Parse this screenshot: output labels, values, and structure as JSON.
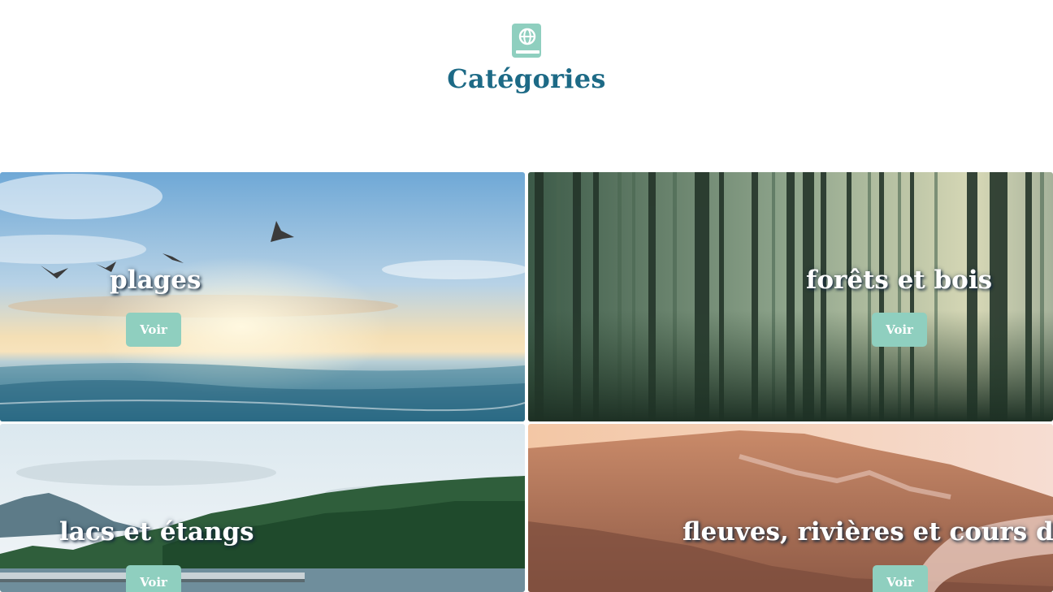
{
  "header": {
    "logo_icon": "travel-guide-book-globe-icon",
    "title": "Catégories"
  },
  "colors": {
    "title": "#1d6a86",
    "logo": "#8fcfbf",
    "button": "#8fcfbf",
    "button_text": "#ffffff",
    "card_title": "#ffffff"
  },
  "categories": [
    {
      "title": "plages",
      "button_label": "Voir",
      "image": "beach-sunset-seagulls"
    },
    {
      "title": "forêts et bois",
      "button_label": "Voir",
      "image": "pine-forest-sunlight"
    },
    {
      "title": "lacs et étangs",
      "button_label": "Voir",
      "image": "lake-forest-dock"
    },
    {
      "title": "fleuves, rivières et cours d'eau",
      "button_label": "Voir",
      "image": "river-mountains-sunset"
    }
  ]
}
